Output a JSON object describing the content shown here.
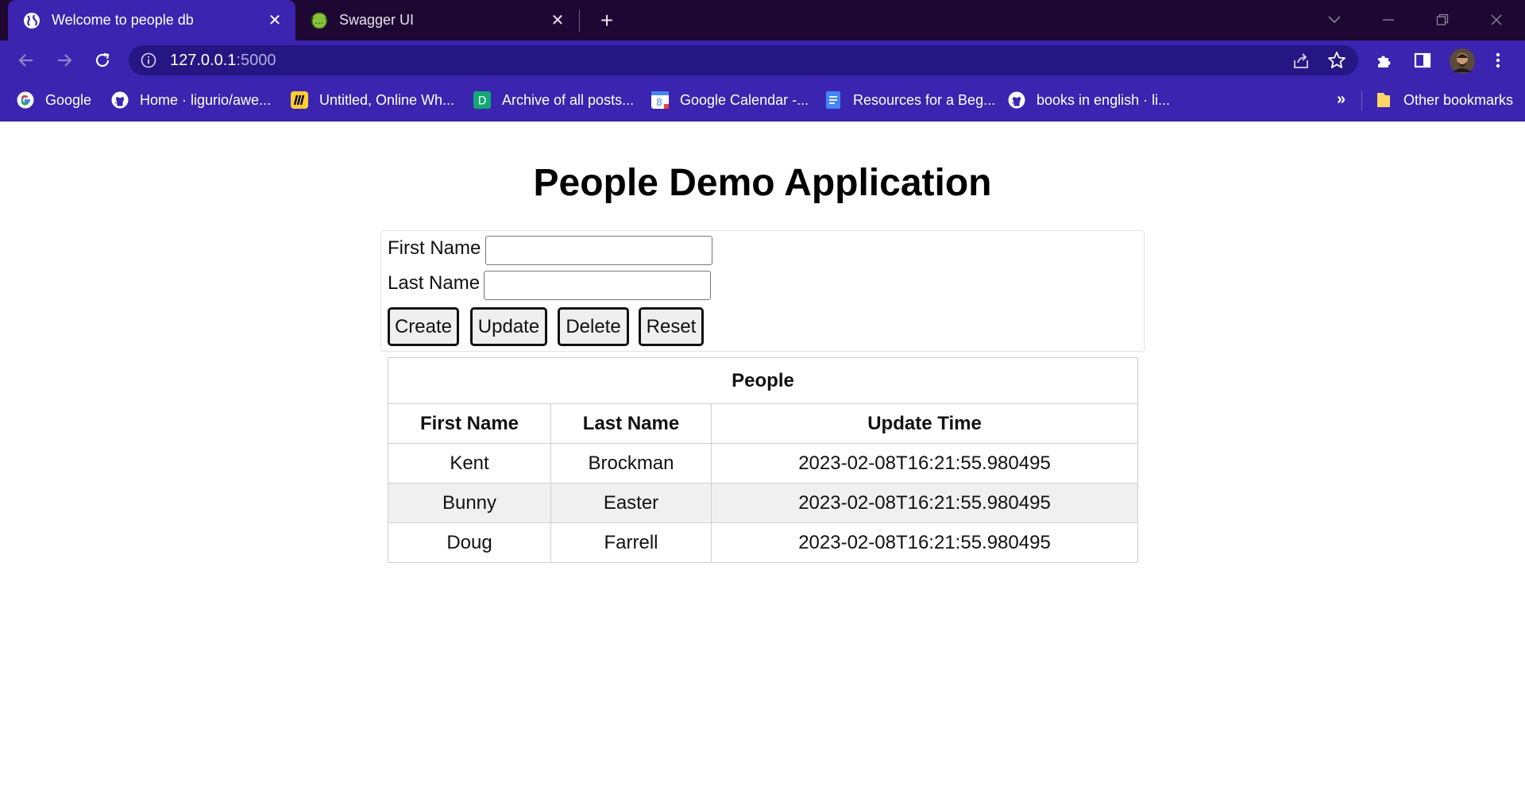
{
  "browser": {
    "tabs": [
      {
        "title": "Welcome to people db",
        "active": true,
        "icon": "globe-icon"
      },
      {
        "title": "Swagger UI",
        "active": false,
        "icon": "swagger-icon"
      }
    ],
    "url_host": "127.0.0.1",
    "url_port": ":5000",
    "bookmarks": [
      {
        "label": "Google",
        "icon": "google-icon"
      },
      {
        "label": "Home · ligurio/awe...",
        "icon": "github-icon"
      },
      {
        "label": "Untitled, Online Wh...",
        "icon": "miro-icon"
      },
      {
        "label": "Archive of all posts...",
        "icon": "d-icon"
      },
      {
        "label": "Google Calendar -...",
        "icon": "calendar-icon"
      },
      {
        "label": "Resources for a Beg...",
        "icon": "docs-icon"
      },
      {
        "label": "books in english · li...",
        "icon": "github-icon"
      }
    ],
    "more_bookmarks": "»",
    "other_bookmarks": "Other bookmarks",
    "colors": {
      "tabstrip": "#1f0733",
      "toolbar": "#3b24b0",
      "omnibox": "#261683"
    }
  },
  "page": {
    "title": "People Demo Application",
    "form": {
      "first_name_label": "First Name",
      "last_name_label": "Last Name",
      "first_name_value": "",
      "last_name_value": "",
      "buttons": {
        "create": "Create",
        "update": "Update",
        "delete": "Delete",
        "reset": "Reset"
      }
    },
    "table": {
      "caption": "People",
      "headers": [
        "First Name",
        "Last Name",
        "Update Time"
      ],
      "rows": [
        [
          "Kent",
          "Brockman",
          "2023-02-08T16:21:55.980495"
        ],
        [
          "Bunny",
          "Easter",
          "2023-02-08T16:21:55.980495"
        ],
        [
          "Doug",
          "Farrell",
          "2023-02-08T16:21:55.980495"
        ]
      ]
    }
  }
}
